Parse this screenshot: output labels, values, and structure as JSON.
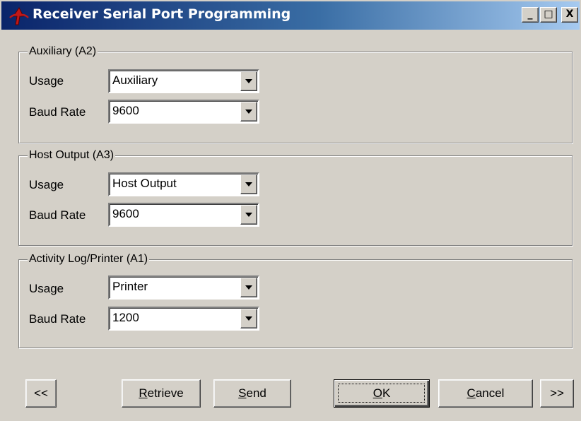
{
  "window": {
    "title": "Receiver Serial Port Programming",
    "app_icon": "receiver-app-icon",
    "controls": {
      "minimize": "_",
      "maximize": "□",
      "close": "X"
    }
  },
  "groups": [
    {
      "title": "Auxiliary (A2)",
      "usage_label": "Usage",
      "usage_value": "Auxiliary",
      "baud_label": "Baud Rate",
      "baud_value": "9600"
    },
    {
      "title": "Host Output (A3)",
      "usage_label": "Usage",
      "usage_value": "Host Output",
      "baud_label": "Baud Rate",
      "baud_value": "9600"
    },
    {
      "title": "Activity Log/Printer (A1)",
      "usage_label": "Usage",
      "usage_value": "Printer",
      "baud_label": "Baud Rate",
      "baud_value": "1200"
    }
  ],
  "buttons": {
    "prev": "<<",
    "retrieve_accel": "R",
    "retrieve_rest": "etrieve",
    "send_accel": "S",
    "send_rest": "end",
    "ok_accel": "O",
    "ok_rest": "K",
    "cancel_accel": "C",
    "cancel_rest": "ancel",
    "next": ">>"
  },
  "colors": {
    "face": "#d4d0c8",
    "title_start": "#0a246a",
    "title_end": "#a6caf0"
  }
}
